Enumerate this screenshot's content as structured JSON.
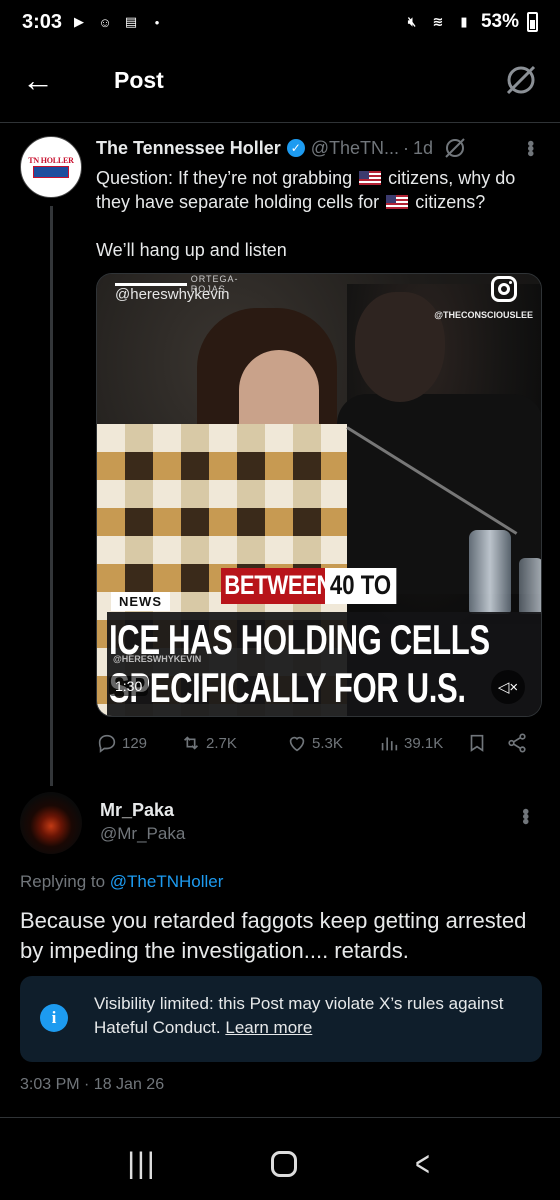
{
  "status_bar": {
    "time": "3:03",
    "battery": "53%"
  },
  "header": {
    "title": "Post"
  },
  "tweet": {
    "author_name": "The Tennessee Holler",
    "handle": "@TheTN...",
    "separator": "·",
    "time": "1d",
    "text_part1": "Question: If they’re not grabbing ",
    "text_part2": " citizens, why do they have separate holding cells for ",
    "text_part3": " citizens?",
    "text_line2": "We’ll hang up and listen",
    "avatar_text": "TN HOLLER",
    "media": {
      "top_label": "ORTEGA-ROJAS",
      "watermark_handle": "@hereswhykevin",
      "watermark_conscious": "@THECONSCIOUSLEE",
      "caption_between": "BETWEEN",
      "caption_40": "40 TO",
      "news_tag": "NEWS",
      "caption_line1": "ICE HAS HOLDING CELLS",
      "caption_line2": "SPECIFICALLY FOR U.S.",
      "caption_watermark": "@HERESWHYKEVIN",
      "duration": "1:30"
    },
    "stats": {
      "replies": "129",
      "reposts": "2.7K",
      "likes": "5.3K",
      "views": "39.1K"
    }
  },
  "reply": {
    "author_name": "Mr_Paka",
    "handle": "@Mr_Paka",
    "replying_prefix": "Replying to ",
    "replying_to": "@TheTNHoller",
    "text": "Because you retarded faggots keep getting arrested by impeding the investigation.... retards.",
    "notice_text": "Visibility limited: this Post may violate X’s rules against Hateful Conduct. ",
    "notice_link": "Learn more",
    "timestamp": "3:03 PM · 18 Jan 26"
  },
  "colors": {
    "background": "#000000",
    "accent": "#1d9bf0",
    "muted": "#71767b",
    "notice_bg": "#0f1e2b"
  },
  "icons": [
    "back-arrow-icon",
    "grok-icon",
    "verified-icon",
    "more-icon",
    "instagram-icon",
    "mute-icon",
    "reply-icon",
    "repost-icon",
    "like-icon",
    "views-icon",
    "bookmark-icon",
    "share-icon",
    "info-icon",
    "nav-recents-icon",
    "nav-home-icon",
    "nav-back-icon"
  ]
}
